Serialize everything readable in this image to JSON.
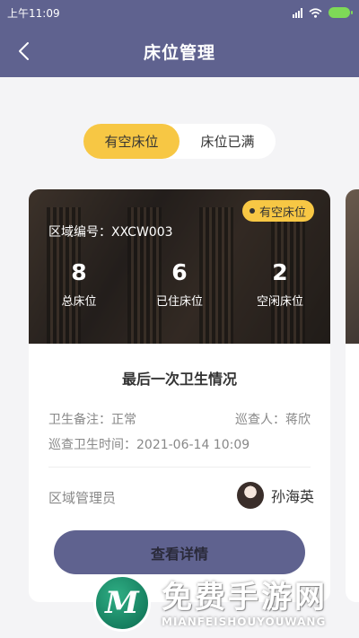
{
  "status_bar": {
    "time": "上午11:09"
  },
  "nav": {
    "title": "床位管理"
  },
  "tabs": [
    {
      "label": "有空床位",
      "active": true
    },
    {
      "label": "床位已满",
      "active": false
    }
  ],
  "card": {
    "badge": "有空床位",
    "area_code": "区域编号：XXCW003",
    "stats": [
      {
        "value": "8",
        "label": "总床位"
      },
      {
        "value": "6",
        "label": "已住床位"
      },
      {
        "value": "2",
        "label": "空闲床位"
      }
    ],
    "section_title": "最后一次卫生情况",
    "hygiene_note": "卫生备注：正常",
    "inspector": "巡查人：蒋欣",
    "inspection_time": "巡查卫生时间：2021-06-14 10:09",
    "manager_label": "区域管理员",
    "manager_name": "孙海英",
    "detail_button": "查看详情"
  },
  "watermark": {
    "title": "免费手游网",
    "subtitle": "MIANFEISHOUYOUWANG"
  },
  "colors": {
    "primary": "#5f628f",
    "accent": "#f7c744",
    "background": "#f4f4f6"
  }
}
